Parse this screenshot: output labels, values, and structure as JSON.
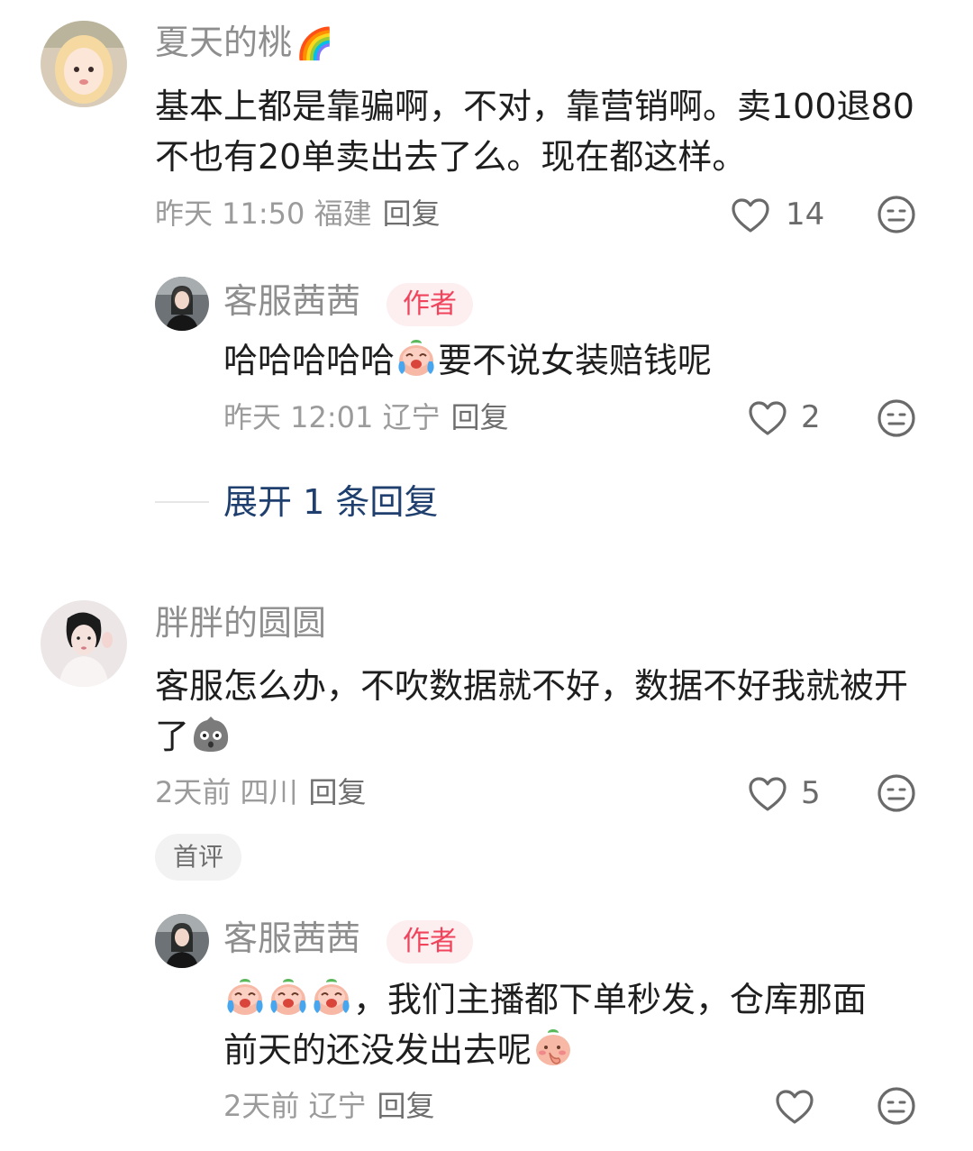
{
  "comments": [
    {
      "username": "夏天的桃",
      "badge_emoji": "🌈",
      "text": "基本上都是靠骗啊，不对，靠营销啊。卖100退80不也有20单卖出去了么。现在都这样。",
      "meta": "昨天 11:50 福建",
      "reply_label": "回复",
      "likes": "14"
    },
    {
      "username": "客服茜茜",
      "author_tag": "作者",
      "text_before": "哈哈哈哈哈",
      "text_after": "要不说女装赔钱呢",
      "meta": "昨天 12:01 辽宁",
      "reply_label": "回复",
      "likes": "2"
    },
    {
      "expand_label": "展开 1 条回复"
    },
    {
      "username": "胖胖的圆圆",
      "text": "客服怎么办，不吹数据就不好，数据不好我就被开了",
      "meta": "2天前 四川",
      "reply_label": "回复",
      "likes": "5",
      "first_tag": "首评"
    },
    {
      "username": "客服茜茜",
      "author_tag": "作者",
      "text_line1": "，我们主播都下单秒发，仓库那面",
      "text_line2": "前天的还没发出去呢",
      "meta": "2天前 辽宁",
      "reply_label": "回复"
    }
  ],
  "icons": {
    "like": "heart-outline-icon",
    "dislike": "meh-face-icon",
    "crying_emoji": "crying-peach-emoji",
    "shy_emoji": "shy-peach-emoji",
    "shocked_emoji": "shocked-rock-emoji"
  },
  "colors": {
    "author_tag_bg": "#fdeef0",
    "author_tag_text": "#f0435c",
    "expand_text": "#1f3f6e"
  }
}
